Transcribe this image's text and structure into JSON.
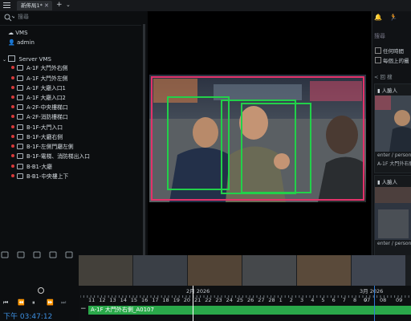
{
  "topbar": {
    "tab_label": "新佈局1*",
    "tab_close": "✕",
    "add_tab": "+",
    "tab_menu": "⌄"
  },
  "left": {
    "search_placeholder": "搜尋",
    "tree": {
      "vms": "VMS",
      "admin": "admin",
      "server": "Server VMS",
      "cameras": [
        "A-1F 大門外右側",
        "A-1F 大門外左側",
        "A-1F 大廳入口1",
        "A-1F 大廳入口2",
        "A-2F-中央樓梯口",
        "A-2F-消防樓梯口",
        "B-1F-大門入口",
        "B-1F-大廳右側",
        "B-1F-左側門廳左側",
        "B-1F-電梯、消防梯出入口",
        "B-B1-大廳",
        "B-B1-中央樓上下"
      ]
    }
  },
  "right": {
    "search_label": "搜尋",
    "check1": "任何時間",
    "check2": "每個上的攝",
    "section_label": "< 回 搜",
    "card_title": "人臉人",
    "card1_meta1": "enter / person",
    "card1_meta2": "A-1F 大門外右側",
    "card2_meta1": "enter / person"
  },
  "timeline": {
    "month1": "2月 2026",
    "month2": "3月 2026",
    "days": [
      "11",
      "12",
      "13",
      "14",
      "15",
      "16",
      "17",
      "18",
      "19",
      "20",
      "21",
      "22",
      "23",
      "24",
      "25",
      "26",
      "27",
      "28",
      "1",
      "2",
      "3",
      "4",
      "5",
      "6",
      "7",
      "8",
      "9"
    ],
    "days_right": [
      "07",
      "08",
      "09"
    ],
    "recording_label": "A-1F 大門外右側_A0107",
    "clock": "下午 03:47:12"
  },
  "colors": {
    "accent_red": "#e3326a",
    "detect_green": "#22d04a",
    "record_green": "#2aa84a",
    "clock_blue": "#3d8fe0"
  }
}
